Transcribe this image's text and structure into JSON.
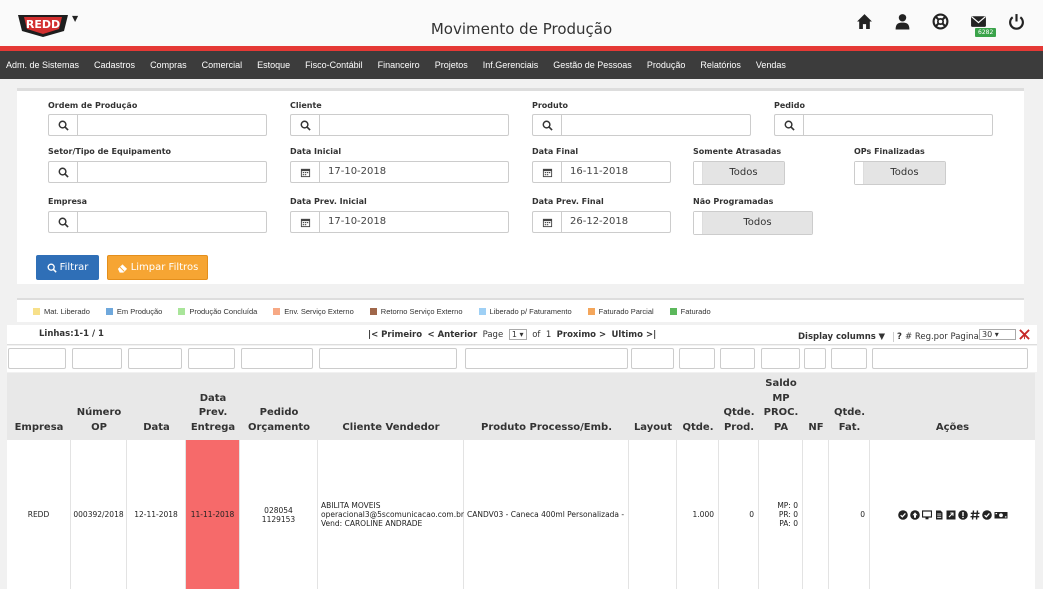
{
  "header": {
    "title": "Movimento de Produção",
    "mail_badge": "6282",
    "logo_text": "REDD"
  },
  "menu": [
    "Adm. de Sistemas",
    "Cadastros",
    "Compras",
    "Comercial",
    "Estoque",
    "Fisco-Contábil",
    "Financeiro",
    "Projetos",
    "Inf.Gerenciais",
    "Gestão de Pessoas",
    "Produção",
    "Relatórios",
    "Vendas"
  ],
  "filters": {
    "ordem_producao": {
      "label": "Ordem de Produção",
      "value": ""
    },
    "cliente": {
      "label": "Cliente",
      "value": ""
    },
    "produto": {
      "label": "Produto",
      "value": ""
    },
    "pedido": {
      "label": "Pedido",
      "value": ""
    },
    "setor": {
      "label": "Setor/Tipo de Equipamento",
      "value": ""
    },
    "data_inicial": {
      "label": "Data Inicial",
      "value": "17-10-2018"
    },
    "data_final": {
      "label": "Data Final",
      "value": "16-11-2018"
    },
    "somente_atrasadas": {
      "label": "Somente Atrasadas",
      "value": "Todos"
    },
    "ops_finalizadas": {
      "label": "OPs Finalizadas",
      "value": "Todos"
    },
    "empresa": {
      "label": "Empresa",
      "value": ""
    },
    "data_prev_inicial": {
      "label": "Data Prev. Inicial",
      "value": "17-10-2018"
    },
    "data_prev_final": {
      "label": "Data Prev. Final",
      "value": "26-12-2018"
    },
    "nao_programadas": {
      "label": "Não Programadas",
      "value": "Todos"
    },
    "btn_filtrar": "Filtrar",
    "btn_limpar": "Limpar Filtros"
  },
  "legend": [
    {
      "label": "Mat. Liberado",
      "color": "#f7e08a"
    },
    {
      "label": "Em Produção",
      "color": "#6fa8dc"
    },
    {
      "label": "Produção Concluída",
      "color": "#a9e59a"
    },
    {
      "label": "Env. Serviço Externo",
      "color": "#f7a985"
    },
    {
      "label": "Retorno Serviço Externo",
      "color": "#a0674a"
    },
    {
      "label": "Liberado p/ Faturamento",
      "color": "#9fd0f5"
    },
    {
      "label": "Faturado Parcial",
      "color": "#f4a65b"
    },
    {
      "label": "Faturado",
      "color": "#5cb85c"
    }
  ],
  "pager": {
    "linhas": "Linhas:1-1 / 1",
    "primeiro": "|< Primeiro",
    "anterior": "< Anterior",
    "page_label": "Page",
    "page_value": "1",
    "of_label": "of",
    "total_pages": "1",
    "proximo": "Proximo >",
    "ultimo": "Ultimo >|",
    "display_columns": "Display columns",
    "help": "?",
    "reg_label": "# Reg.por Pagina",
    "reg_value": "30"
  },
  "table": {
    "headers": {
      "empresa": "Empresa",
      "numero_op": "Número OP",
      "data": "Data",
      "data_prev": "Data Prev. Entrega",
      "pedido": "Pedido Orçamento",
      "cliente": "Cliente Vendedor",
      "produto": "Produto Processo/Emb.",
      "layout": "Layout",
      "qtde": "Qtde.",
      "qtde_prod": "Qtde. Prod.",
      "saldo": "Saldo MP PROC. PA",
      "nf": "NF",
      "qtde_fat": "Qtde. Fat.",
      "acoes": "Ações"
    },
    "row": {
      "empresa": "REDD",
      "numero_op": "000392/2018",
      "data": "12-11-2018",
      "data_prev": "11-11-2018",
      "pedido_1": "028054",
      "pedido_2": "1129153",
      "cliente_1": "ABILITA MOVEIS",
      "cliente_2": "operacional3@5scomunicacao.com.br",
      "cliente_3": "Vend: CAROLINE ANDRADE",
      "produto": "CANDV03 - Caneca 400ml Personalizada -",
      "layout": "",
      "qtde": "1.000",
      "qtde_prod": "0",
      "saldo_mp": "MP: 0",
      "saldo_pr": "PR: 0",
      "saldo_pa": "PA: 0",
      "nf": "",
      "qtde_fat": "0",
      "late_color": "#f66a6a"
    }
  }
}
